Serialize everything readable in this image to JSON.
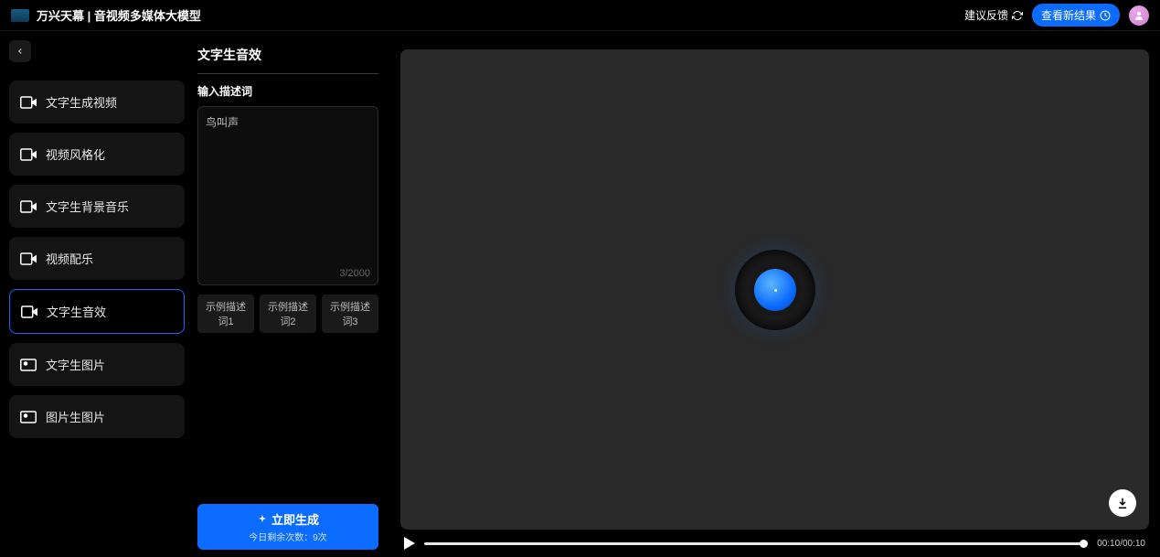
{
  "header": {
    "brand": "万兴天幕 | 音视频多媒体大模型",
    "feedback": "建议反馈",
    "view_results": "查看新结果"
  },
  "sidebar": {
    "items": [
      {
        "label": "文字生成视频",
        "active": false
      },
      {
        "label": "视频风格化",
        "active": false
      },
      {
        "label": "文字生背景音乐",
        "active": false
      },
      {
        "label": "视频配乐",
        "active": false
      },
      {
        "label": "文字生音效",
        "active": true
      },
      {
        "label": "文字生图片",
        "active": false
      },
      {
        "label": "图片生图片",
        "active": false
      }
    ]
  },
  "panel": {
    "title": "文字生音效",
    "input_label": "输入描述词",
    "input_value": "鸟叫声",
    "char_count": "3/2000",
    "examples": [
      "示例描述词1",
      "示例描述词2",
      "示例描述词3"
    ],
    "generate_label": "立即生成",
    "generate_sub": "今日剩余次数：9次"
  },
  "player": {
    "current_time": "00:10",
    "total_time": "00:10"
  }
}
